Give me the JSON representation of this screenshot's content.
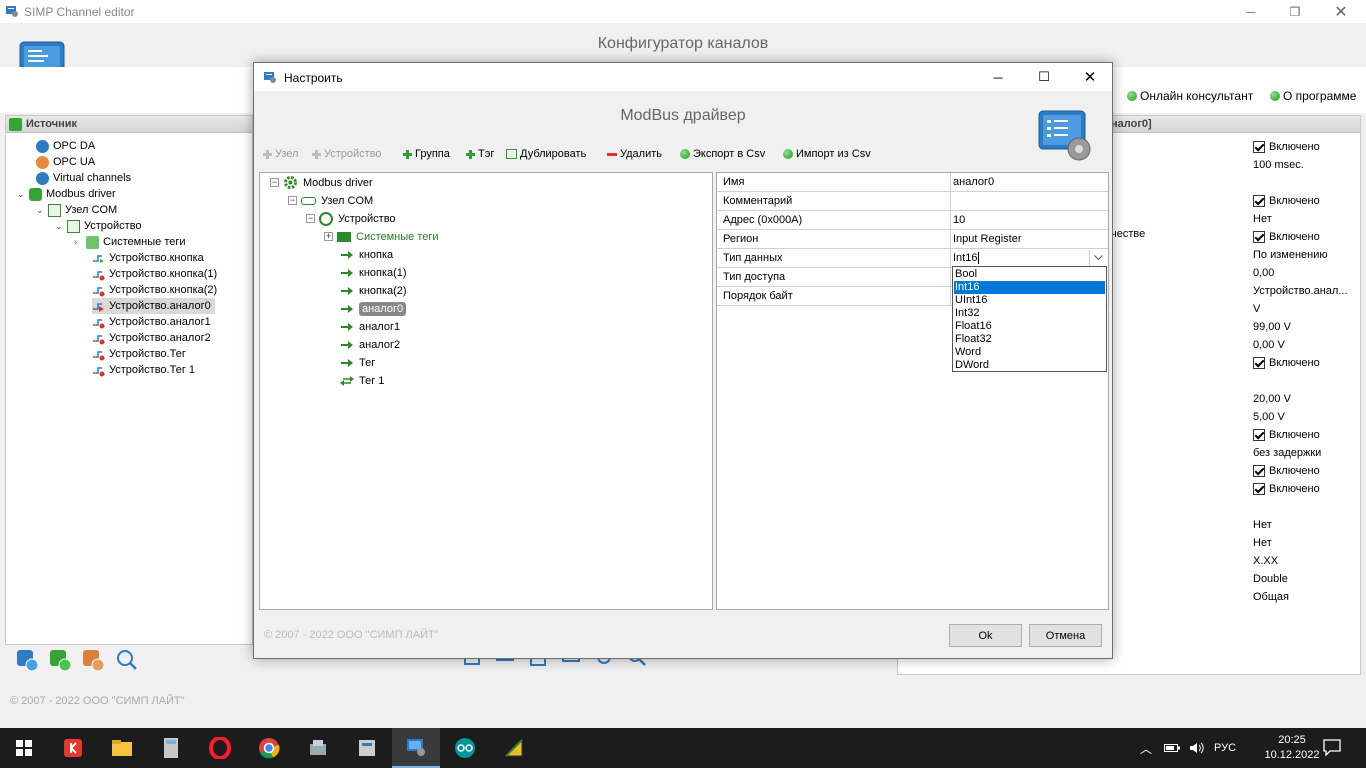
{
  "main": {
    "window_title": "SIMP Channel editor",
    "heading": "Конфигуратор каналов",
    "toolbar_links": [
      {
        "label": "Онлайн консультант"
      },
      {
        "label": "О программе"
      }
    ],
    "footer": "© 2007 - 2022  ООО \"СИМП ЛАЙТ\"",
    "left_panel": {
      "header": "Источник",
      "items": [
        {
          "label": "OPC DA"
        },
        {
          "label": "OPC UA"
        },
        {
          "label": "Virtual channels"
        },
        {
          "label": "Modbus driver"
        },
        {
          "label": "Узел COM"
        },
        {
          "label": "Устройство"
        },
        {
          "label": "Системные теги"
        },
        {
          "label": "Устройство.кнопка"
        },
        {
          "label": "Устройство.кнопка(1)"
        },
        {
          "label": "Устройство.кнопка(2)"
        },
        {
          "label": "Устройство.аналог0"
        },
        {
          "label": "Устройство.аналог1"
        },
        {
          "label": "Устройство.аналог2"
        },
        {
          "label": "Устройство.Тег"
        },
        {
          "label": "Устройство.Тег 1"
        }
      ]
    },
    "right_panel": {
      "header": "налог0]",
      "fragment": "честве",
      "values": [
        {
          "text": "Включено",
          "check": true
        },
        {
          "text": "100 msec.",
          "check": false
        },
        {
          "text": "",
          "check": false
        },
        {
          "text": "Включено",
          "check": true
        },
        {
          "text": "Нет",
          "check": false
        },
        {
          "text": "Включено",
          "check": true
        },
        {
          "text": "По изменению",
          "check": false
        },
        {
          "text": "0,00",
          "check": false
        },
        {
          "text": "Устройство.анал...",
          "check": false
        },
        {
          "text": "V",
          "check": false
        },
        {
          "text": "99,00 V",
          "check": false
        },
        {
          "text": "0,00 V",
          "check": false
        },
        {
          "text": "Включено",
          "check": true
        },
        {
          "text": "",
          "check": false
        },
        {
          "text": "20,00 V",
          "check": false
        },
        {
          "text": "5,00 V",
          "check": false
        },
        {
          "text": "Включено",
          "check": true
        },
        {
          "text": "без задержки",
          "check": false
        },
        {
          "text": "Включено",
          "check": true
        },
        {
          "text": "Включено",
          "check": true
        },
        {
          "text": "",
          "check": false
        },
        {
          "text": "Нет",
          "check": false
        },
        {
          "text": "Нет",
          "check": false
        },
        {
          "text": "X.XX",
          "check": false
        },
        {
          "text": "Double",
          "check": false
        },
        {
          "text": "Общая",
          "check": false
        }
      ]
    }
  },
  "dialog": {
    "title": "Настроить",
    "heading": "ModBus драйвер",
    "toolbar": {
      "node": "Узел",
      "device": "Устройство",
      "group": "Группа",
      "tag": "Тэг",
      "duplicate": "Дублировать",
      "delete": "Удалить",
      "export_csv": "Экспорт в Csv",
      "import_csv": "Импорт из Csv"
    },
    "tree": [
      {
        "label": "Modbus driver"
      },
      {
        "label": "Узел COM"
      },
      {
        "label": "Устройство"
      },
      {
        "label": "Системные теги"
      },
      {
        "label": "кнопка"
      },
      {
        "label": "кнопка(1)"
      },
      {
        "label": "кнопка(2)"
      },
      {
        "label": "аналог0"
      },
      {
        "label": "аналог1"
      },
      {
        "label": "аналог2"
      },
      {
        "label": "Тег"
      },
      {
        "label": "Тег 1"
      }
    ],
    "properties": [
      {
        "name": "Имя",
        "value": "аналог0"
      },
      {
        "name": "Комментарий",
        "value": ""
      },
      {
        "name": "Адрес (0x000A)",
        "value": "10"
      },
      {
        "name": "Регион",
        "value": "Input Register"
      },
      {
        "name": "Тип данных",
        "value": "Int16"
      },
      {
        "name": "Тип доступа",
        "value": ""
      },
      {
        "name": "Порядок байт",
        "value": ""
      }
    ],
    "dropdown_options": [
      "Bool",
      "Int16",
      "UInt16",
      "Int32",
      "Float16",
      "Float32",
      "Word",
      "DWord"
    ],
    "dropdown_selected": "Int16",
    "copyright": "© 2007 - 2022  ООО \"СИМП ЛАЙТ\"",
    "ok": "Ok",
    "cancel": "Отмена"
  },
  "taskbar": {
    "language": "РУС",
    "time": "20:25",
    "date": "10.12.2022"
  }
}
